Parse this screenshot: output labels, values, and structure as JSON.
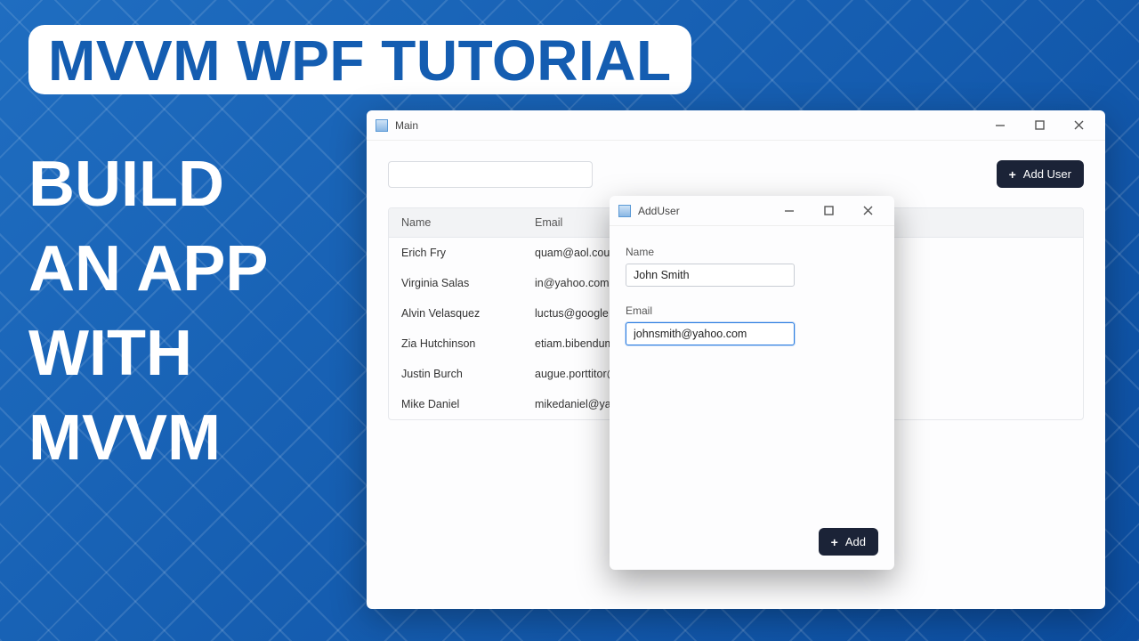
{
  "banner": {
    "title": "MVVM WPF TUTORIAL",
    "subtitle": "BUILD\nAN APP\nWITH\nMVVM"
  },
  "mainWindow": {
    "title": "Main",
    "searchValue": "",
    "addUserLabel": "Add User",
    "columns": [
      "Name",
      "Email"
    ],
    "rows": [
      {
        "name": "Erich Fry",
        "email": "quam@aol.couk"
      },
      {
        "name": "Virginia Salas",
        "email": "in@yahoo.com"
      },
      {
        "name": "Alvin Velasquez",
        "email": "luctus@google.com"
      },
      {
        "name": "Zia Hutchinson",
        "email": "etiam.bibendum@hot"
      },
      {
        "name": "Justin Burch",
        "email": "augue.porttitor@prot"
      },
      {
        "name": "Mike Daniel",
        "email": "mikedaniel@yahoo.co"
      }
    ]
  },
  "dialog": {
    "title": "AddUser",
    "nameLabel": "Name",
    "nameValue": "John Smith",
    "emailLabel": "Email",
    "emailValue": "johnsmith@yahoo.com",
    "addLabel": "Add"
  }
}
